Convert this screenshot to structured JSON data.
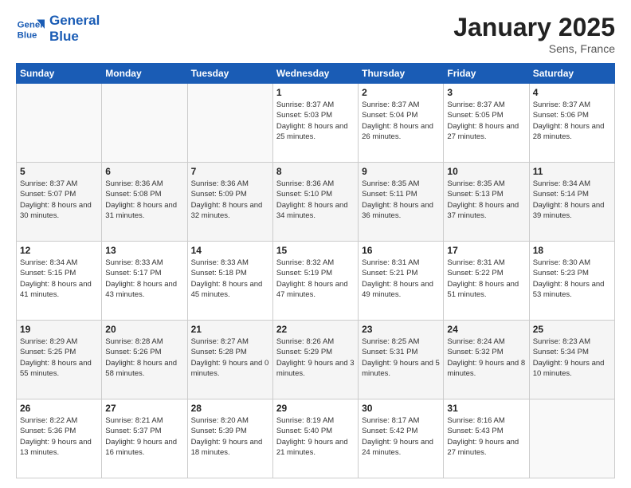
{
  "logo": {
    "line1": "General",
    "line2": "Blue"
  },
  "header": {
    "month": "January 2025",
    "location": "Sens, France"
  },
  "weekdays": [
    "Sunday",
    "Monday",
    "Tuesday",
    "Wednesday",
    "Thursday",
    "Friday",
    "Saturday"
  ],
  "weeks": [
    [
      {
        "day": "",
        "info": ""
      },
      {
        "day": "",
        "info": ""
      },
      {
        "day": "",
        "info": ""
      },
      {
        "day": "1",
        "info": "Sunrise: 8:37 AM\nSunset: 5:03 PM\nDaylight: 8 hours\nand 25 minutes."
      },
      {
        "day": "2",
        "info": "Sunrise: 8:37 AM\nSunset: 5:04 PM\nDaylight: 8 hours\nand 26 minutes."
      },
      {
        "day": "3",
        "info": "Sunrise: 8:37 AM\nSunset: 5:05 PM\nDaylight: 8 hours\nand 27 minutes."
      },
      {
        "day": "4",
        "info": "Sunrise: 8:37 AM\nSunset: 5:06 PM\nDaylight: 8 hours\nand 28 minutes."
      }
    ],
    [
      {
        "day": "5",
        "info": "Sunrise: 8:37 AM\nSunset: 5:07 PM\nDaylight: 8 hours\nand 30 minutes."
      },
      {
        "day": "6",
        "info": "Sunrise: 8:36 AM\nSunset: 5:08 PM\nDaylight: 8 hours\nand 31 minutes."
      },
      {
        "day": "7",
        "info": "Sunrise: 8:36 AM\nSunset: 5:09 PM\nDaylight: 8 hours\nand 32 minutes."
      },
      {
        "day": "8",
        "info": "Sunrise: 8:36 AM\nSunset: 5:10 PM\nDaylight: 8 hours\nand 34 minutes."
      },
      {
        "day": "9",
        "info": "Sunrise: 8:35 AM\nSunset: 5:11 PM\nDaylight: 8 hours\nand 36 minutes."
      },
      {
        "day": "10",
        "info": "Sunrise: 8:35 AM\nSunset: 5:13 PM\nDaylight: 8 hours\nand 37 minutes."
      },
      {
        "day": "11",
        "info": "Sunrise: 8:34 AM\nSunset: 5:14 PM\nDaylight: 8 hours\nand 39 minutes."
      }
    ],
    [
      {
        "day": "12",
        "info": "Sunrise: 8:34 AM\nSunset: 5:15 PM\nDaylight: 8 hours\nand 41 minutes."
      },
      {
        "day": "13",
        "info": "Sunrise: 8:33 AM\nSunset: 5:17 PM\nDaylight: 8 hours\nand 43 minutes."
      },
      {
        "day": "14",
        "info": "Sunrise: 8:33 AM\nSunset: 5:18 PM\nDaylight: 8 hours\nand 45 minutes."
      },
      {
        "day": "15",
        "info": "Sunrise: 8:32 AM\nSunset: 5:19 PM\nDaylight: 8 hours\nand 47 minutes."
      },
      {
        "day": "16",
        "info": "Sunrise: 8:31 AM\nSunset: 5:21 PM\nDaylight: 8 hours\nand 49 minutes."
      },
      {
        "day": "17",
        "info": "Sunrise: 8:31 AM\nSunset: 5:22 PM\nDaylight: 8 hours\nand 51 minutes."
      },
      {
        "day": "18",
        "info": "Sunrise: 8:30 AM\nSunset: 5:23 PM\nDaylight: 8 hours\nand 53 minutes."
      }
    ],
    [
      {
        "day": "19",
        "info": "Sunrise: 8:29 AM\nSunset: 5:25 PM\nDaylight: 8 hours\nand 55 minutes."
      },
      {
        "day": "20",
        "info": "Sunrise: 8:28 AM\nSunset: 5:26 PM\nDaylight: 8 hours\nand 58 minutes."
      },
      {
        "day": "21",
        "info": "Sunrise: 8:27 AM\nSunset: 5:28 PM\nDaylight: 9 hours\nand 0 minutes."
      },
      {
        "day": "22",
        "info": "Sunrise: 8:26 AM\nSunset: 5:29 PM\nDaylight: 9 hours\nand 3 minutes."
      },
      {
        "day": "23",
        "info": "Sunrise: 8:25 AM\nSunset: 5:31 PM\nDaylight: 9 hours\nand 5 minutes."
      },
      {
        "day": "24",
        "info": "Sunrise: 8:24 AM\nSunset: 5:32 PM\nDaylight: 9 hours\nand 8 minutes."
      },
      {
        "day": "25",
        "info": "Sunrise: 8:23 AM\nSunset: 5:34 PM\nDaylight: 9 hours\nand 10 minutes."
      }
    ],
    [
      {
        "day": "26",
        "info": "Sunrise: 8:22 AM\nSunset: 5:36 PM\nDaylight: 9 hours\nand 13 minutes."
      },
      {
        "day": "27",
        "info": "Sunrise: 8:21 AM\nSunset: 5:37 PM\nDaylight: 9 hours\nand 16 minutes."
      },
      {
        "day": "28",
        "info": "Sunrise: 8:20 AM\nSunset: 5:39 PM\nDaylight: 9 hours\nand 18 minutes."
      },
      {
        "day": "29",
        "info": "Sunrise: 8:19 AM\nSunset: 5:40 PM\nDaylight: 9 hours\nand 21 minutes."
      },
      {
        "day": "30",
        "info": "Sunrise: 8:17 AM\nSunset: 5:42 PM\nDaylight: 9 hours\nand 24 minutes."
      },
      {
        "day": "31",
        "info": "Sunrise: 8:16 AM\nSunset: 5:43 PM\nDaylight: 9 hours\nand 27 minutes."
      },
      {
        "day": "",
        "info": ""
      }
    ]
  ]
}
